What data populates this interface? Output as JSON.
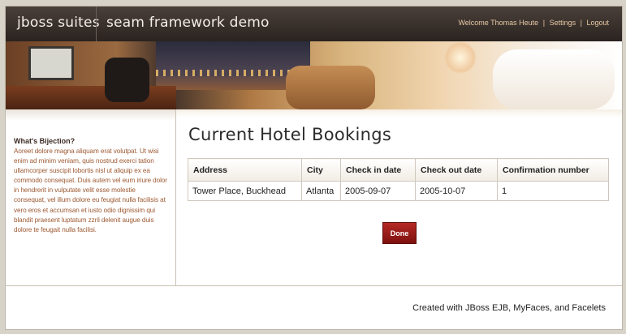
{
  "header": {
    "brand": "jboss suites",
    "app_title": "seam framework demo",
    "welcome": "Welcome Thomas Heute",
    "settings_link": "Settings",
    "logout_link": "Logout",
    "separator": "|"
  },
  "sidebar": {
    "heading": "What's Bijection?",
    "text": "Aoreet dolore magna aliquam erat volutpat. Ut wisi enim ad minim veniam, quis nostrud exerci tation ullamcorper suscipit lobortis nisl ut aliquip ex ea commodo consequat. Duis autem vel eum iriure dolor in hendrerit in vulputate velit esse molestie consequat, vel illum dolore eu feugiat nulla facilisis at vero eros et accumsan et iusto odio dignissim qui blandit praesent luptatum zzril delenit augue duis dolore te feugait nulla facilisi."
  },
  "main": {
    "title": "Current Hotel Bookings",
    "table": {
      "headers": [
        "Address",
        "City",
        "Check in date",
        "Check out date",
        "Confirmation number"
      ],
      "rows": [
        [
          "Tower Place, Buckhead",
          "Atlanta",
          "2005-09-07",
          "2005-10-07",
          "1"
        ]
      ]
    },
    "done_button": "Done"
  },
  "footer": {
    "text": "Created with JBoss EJB, MyFaces, and Facelets"
  },
  "colors": {
    "header_bg": "#2a231f",
    "accent_link": "#e7c9a5",
    "sidebar_text": "#9d5a33",
    "button_bg": "#9b1c18"
  }
}
